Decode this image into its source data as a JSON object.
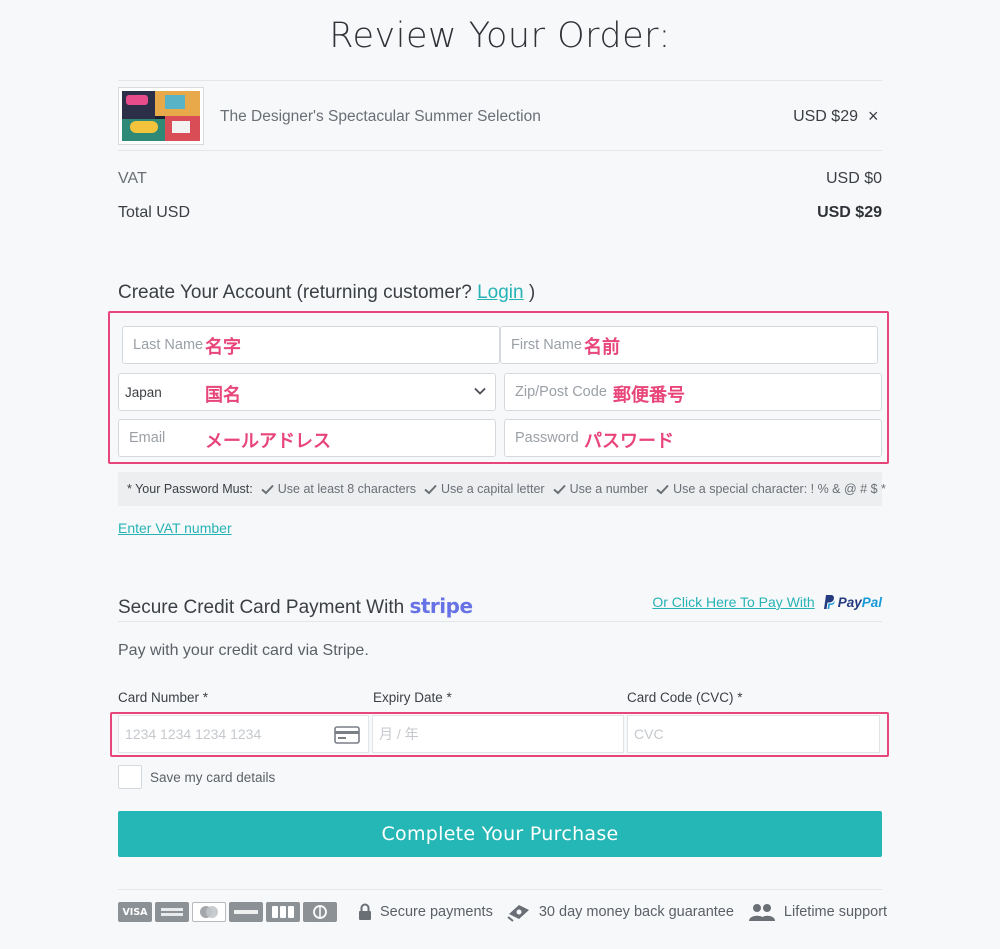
{
  "page_title": "Review Your Order:",
  "order": {
    "product_name": "The Designer's Spectacular Summer Selection",
    "product_price": "USD $29",
    "remove_symbol": "×",
    "vat_label": "VAT",
    "vat_value": "USD $0",
    "total_label": "Total USD",
    "total_value": "USD $29"
  },
  "account": {
    "heading_prefix": "Create Your Account (returning customer? ",
    "login_link": "Login",
    "heading_suffix": " )",
    "last_name_placeholder": "Last Name",
    "last_name_note": "名字",
    "first_name_placeholder": "First Name",
    "first_name_note": "名前",
    "country_value": "Japan",
    "country_note": "国名",
    "zip_placeholder": "Zip/Post Code",
    "zip_note": "郵便番号",
    "email_placeholder": "Email",
    "email_note": "メールアドレス",
    "password_placeholder": "Password",
    "password_note": "パスワード",
    "password_rules_title": "* Your Password Must:",
    "password_rules": [
      "Use at least 8 characters",
      "Use a capital letter",
      "Use a number",
      "Use a special character: ! % & @ # $ *"
    ],
    "vat_link": "Enter VAT number"
  },
  "payment": {
    "heading": "Secure Credit Card Payment With",
    "stripe_logo": "stripe",
    "paypal_link": "Or Click Here To Pay With",
    "paypal_logo_pay": "Pay",
    "paypal_logo_pal": "Pal",
    "note": "Pay with your credit card via Stripe.",
    "card_number_label": "Card Number *",
    "card_number_placeholder": "1234 1234 1234 1234",
    "expiry_label": "Expiry Date *",
    "expiry_placeholder": "月 / 年",
    "cvc_label": "Card Code (CVC) *",
    "cvc_placeholder": "CVC",
    "save_card_label": "Save my card details",
    "submit_label": "Complete Your Purchase"
  },
  "footer": {
    "card_brands": [
      "VISA",
      "AMEX",
      "MC",
      "DISCOVER",
      "JCB",
      "DINERS"
    ],
    "visa_text": "VISA",
    "secure_payments": "Secure payments",
    "guarantee": "30 day money back guarantee",
    "support": "Lifetime support"
  },
  "colors": {
    "accent": "#25b7b5",
    "highlight": "#e8457a",
    "stripe": "#6772e5"
  }
}
